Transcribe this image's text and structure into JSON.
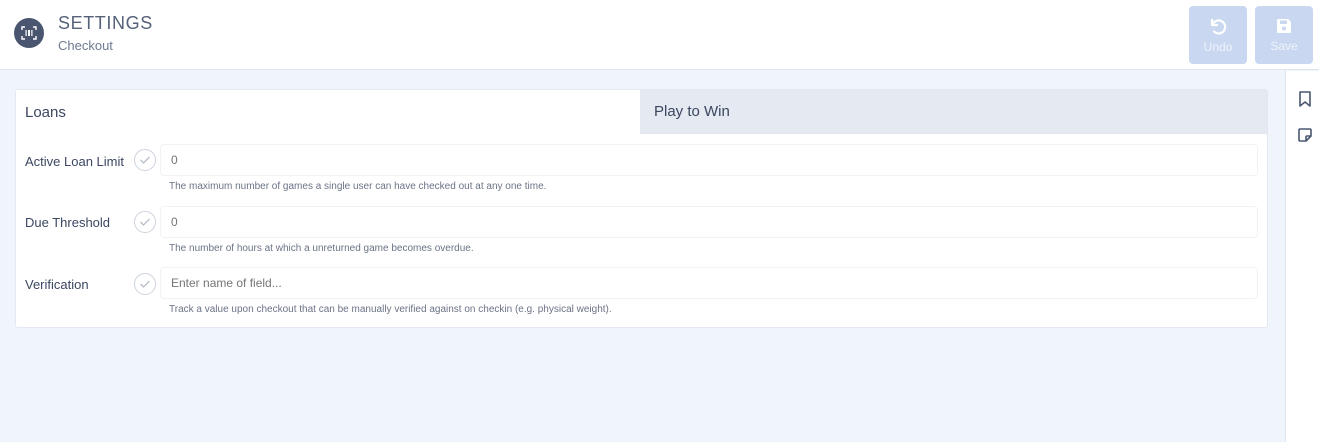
{
  "header": {
    "title": "SETTINGS",
    "subtitle": "Checkout",
    "app_icon": "barcode-scanner-icon",
    "undo_label": "Undo",
    "save_label": "Save"
  },
  "tabs": [
    {
      "label": "Loans",
      "active": true
    },
    {
      "label": "Play to Win",
      "active": false
    }
  ],
  "settings": [
    {
      "label": "Active Loan Limit",
      "value": "",
      "placeholder": "0",
      "help": "The maximum number of games a single user can have checked out at any one time."
    },
    {
      "label": "Due Threshold",
      "value": "",
      "placeholder": "0",
      "help": "The number of hours at which a unreturned game becomes overdue."
    },
    {
      "label": "Verification",
      "value": "",
      "placeholder": "Enter name of field...",
      "help": "Track a value upon checkout that can be manually verified against on checkin (e.g. physical weight)."
    }
  ],
  "rail": {
    "icons": [
      "bookmark-icon",
      "note-icon"
    ]
  },
  "colors": {
    "page_bg": "#f0f4fb",
    "button_disabled": "#c9d8f0",
    "inactive_tab": "#e4e9f2"
  }
}
